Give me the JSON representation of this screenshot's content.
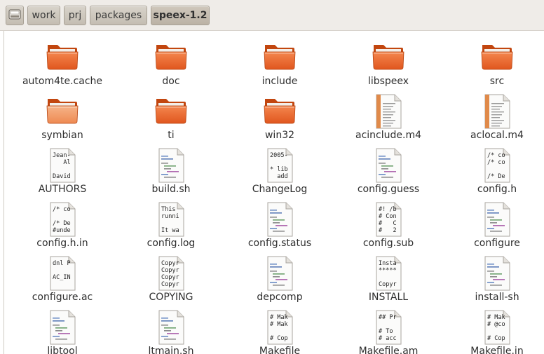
{
  "breadcrumbs": [
    "work",
    "prj",
    "packages",
    "speex-1.2"
  ],
  "drive_icon": "drive-icon",
  "files": [
    {
      "name": "autom4te.cache",
      "kind": "folder"
    },
    {
      "name": "doc",
      "kind": "folder"
    },
    {
      "name": "include",
      "kind": "folder"
    },
    {
      "name": "libspeex",
      "kind": "folder"
    },
    {
      "name": "src",
      "kind": "folder"
    },
    {
      "name": "symbian",
      "kind": "folder-light"
    },
    {
      "name": "ti",
      "kind": "folder"
    },
    {
      "name": "win32",
      "kind": "folder"
    },
    {
      "name": "acinclude.m4",
      "kind": "m4"
    },
    {
      "name": "aclocal.m4",
      "kind": "m4"
    },
    {
      "name": "AUTHORS",
      "kind": "text",
      "preview": [
        "Jean-",
        "   Al",
        "",
        "David"
      ]
    },
    {
      "name": "build.sh",
      "kind": "script"
    },
    {
      "name": "ChangeLog",
      "kind": "text",
      "preview": [
        "2005-",
        "",
        "* lib",
        "  add"
      ]
    },
    {
      "name": "config.guess",
      "kind": "script"
    },
    {
      "name": "config.h",
      "kind": "text",
      "preview": [
        "/* co",
        "/* co",
        "",
        "/* De"
      ]
    },
    {
      "name": "config.h.in",
      "kind": "text",
      "preview": [
        "/* co",
        "",
        "/* De",
        "#unde"
      ]
    },
    {
      "name": "config.log",
      "kind": "text",
      "preview": [
        "This ",
        "runni",
        "",
        "It wa"
      ]
    },
    {
      "name": "config.status",
      "kind": "script"
    },
    {
      "name": "config.sub",
      "kind": "text",
      "preview": [
        "#! /b",
        "# Con",
        "#   C",
        "#   2"
      ]
    },
    {
      "name": "configure",
      "kind": "script"
    },
    {
      "name": "configure.ac",
      "kind": "text",
      "preview": [
        "dnl P",
        "",
        "AC_IN",
        ""
      ]
    },
    {
      "name": "COPYING",
      "kind": "text",
      "preview": [
        "Copyr",
        "Copyr",
        "Copyr",
        "Copyr"
      ]
    },
    {
      "name": "depcomp",
      "kind": "script"
    },
    {
      "name": "INSTALL",
      "kind": "text",
      "preview": [
        "Insta",
        "*****",
        "",
        "Copyr"
      ]
    },
    {
      "name": "install-sh",
      "kind": "script"
    },
    {
      "name": "libtool",
      "kind": "script"
    },
    {
      "name": "ltmain.sh",
      "kind": "script"
    },
    {
      "name": "Makefile",
      "kind": "text",
      "preview": [
        "# Mak",
        "# Mak",
        "",
        "# Cop"
      ]
    },
    {
      "name": "Makefile.am",
      "kind": "text",
      "preview": [
        "## Pr",
        "",
        "# To ",
        "# acc"
      ]
    },
    {
      "name": "Makefile.in",
      "kind": "text",
      "preview": [
        "# Mak",
        "# @co",
        "",
        "# Cop"
      ]
    }
  ]
}
